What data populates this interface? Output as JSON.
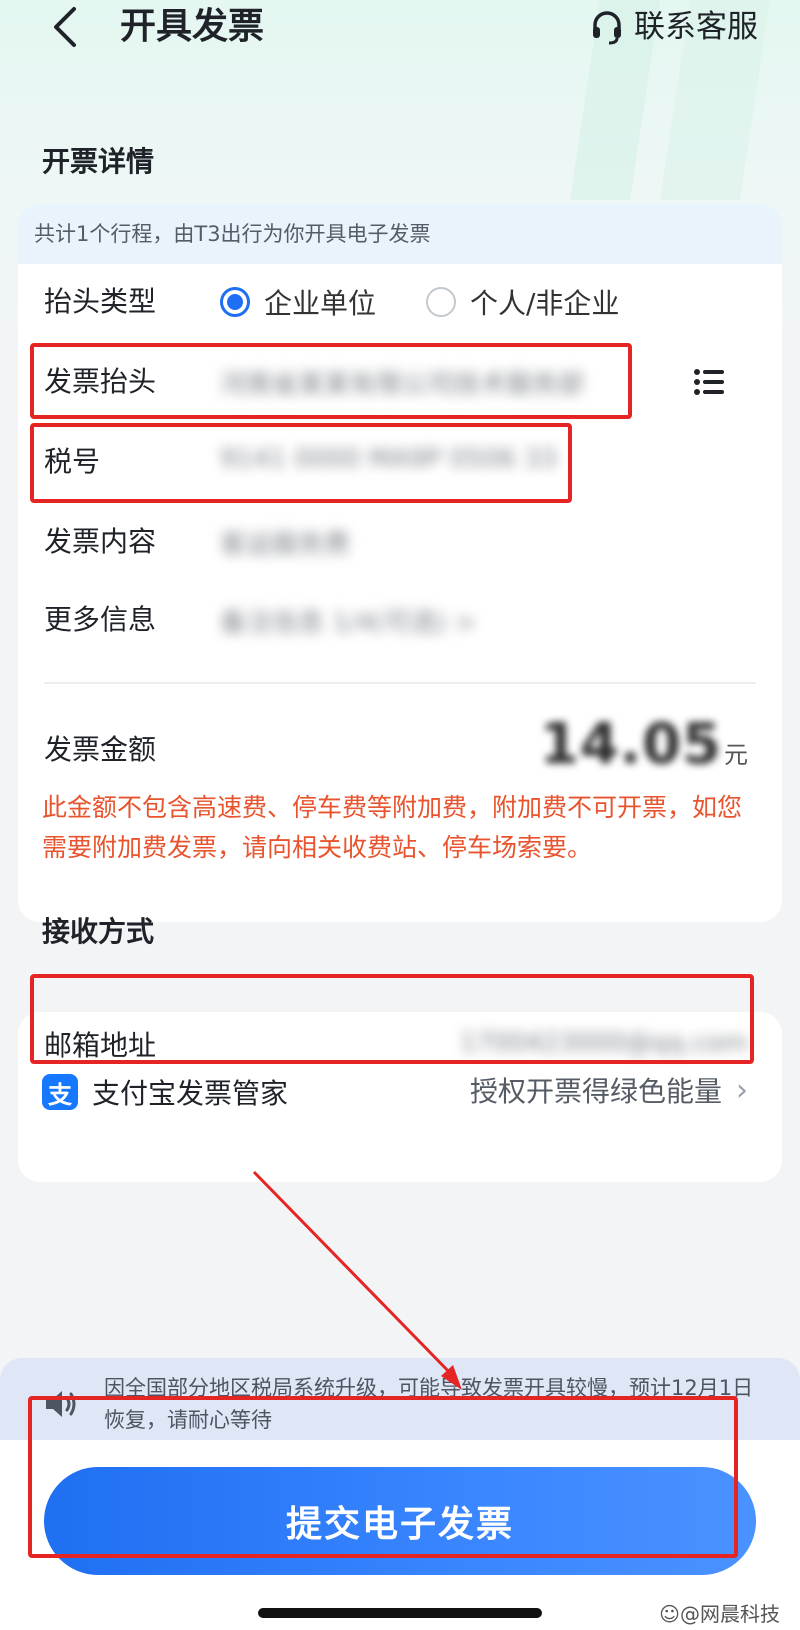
{
  "header": {
    "title": "开具发票",
    "support_label": "联系客服"
  },
  "invoice_details": {
    "section_title": "开票详情",
    "notice": "共计1个行程，由T3出行为你开具电子发票",
    "header_type": {
      "label": "抬头类型",
      "options": [
        {
          "label": "企业单位",
          "selected": true
        },
        {
          "label": "个人/非企业",
          "selected": false
        }
      ]
    },
    "invoice_title": {
      "label": "发票抬头",
      "value": "河南省某某有限公司技术服务部"
    },
    "tax_number": {
      "label": "税号",
      "value": "9141 0000 MA9P 0506 33"
    },
    "content": {
      "label": "发票内容",
      "value": "客运服务费"
    },
    "more_info": {
      "label": "更多信息",
      "value": "备注信息 1/4(可选) >"
    },
    "amount": {
      "label": "发票金额",
      "value": "14.05",
      "unit": "元"
    },
    "warning": "此金额不包含高速费、停车费等附加费，附加费不可开票，如您需要附加费发票，请向相关收费站、停车场索要。"
  },
  "receive": {
    "section_title": "接收方式",
    "email": {
      "label": "邮箱地址",
      "value": "1700423000@qq.com"
    },
    "alipay": {
      "icon_char": "支",
      "label": "支付宝发票管家",
      "action": "授权开票得绿色能量"
    }
  },
  "bottom_notice": "因全国部分地区税局系统升级，可能导致发票开具较慢，预计12月1日恢复，请耐心等待",
  "submit_label": "提交电子发票",
  "watermark": "☺@网晨科技",
  "colors": {
    "accent": "#1e6ff5",
    "warning": "#e8542e",
    "annotation": "#e52424"
  }
}
